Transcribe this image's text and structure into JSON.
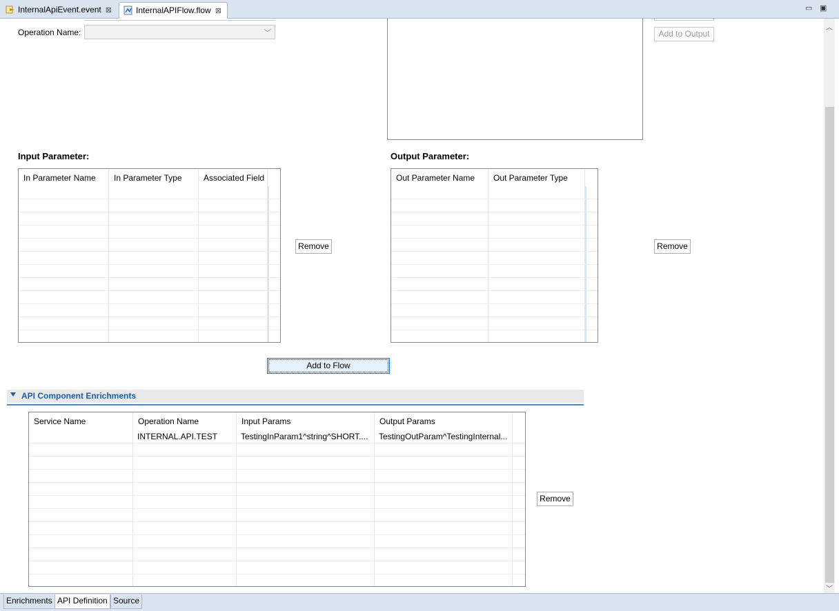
{
  "tabs": [
    {
      "label": "InternalApiEvent.event",
      "icon": "event-file-icon"
    },
    {
      "label": "InternalAPIFlow.flow",
      "icon": "flow-file-icon"
    }
  ],
  "window_controls": {
    "minimize": "▭",
    "restore": "🗗"
  },
  "operation": {
    "label": "Operation Name:",
    "value": ""
  },
  "add_to_output_label": "Add to Output",
  "input_parameter": {
    "title": "Input Parameter:",
    "columns": [
      "In Parameter Name",
      "In Parameter Type",
      "Associated Field"
    ],
    "rows": [],
    "remove_label": "Remove"
  },
  "output_parameter": {
    "title": "Output Parameter:",
    "columns": [
      "Out Parameter Name",
      "Out Parameter Type"
    ],
    "rows": [],
    "remove_label": "Remove"
  },
  "add_to_flow_label": "Add to Flow",
  "enrichments": {
    "title": "API Component Enrichments",
    "columns": [
      "Service Name",
      "Operation Name",
      "Input Params",
      "Output Params"
    ],
    "rows": [
      [
        "",
        "INTERNAL.API.TEST",
        "TestingInParam1^string^SHORT....",
        "TestingOutParam^TestingInternal..."
      ]
    ],
    "remove_label": "Remove"
  },
  "bottom_tabs": [
    "Enrichments",
    "API Definition",
    "Source"
  ],
  "active_bottom_tab": "API Definition",
  "colors": {
    "section_title": "#1b5fa9",
    "tab_bar": "#dae4f0"
  }
}
